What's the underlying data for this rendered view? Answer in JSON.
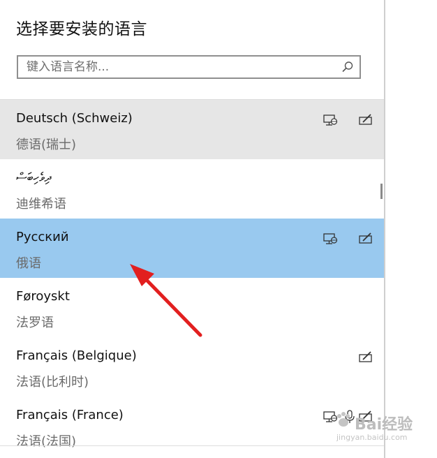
{
  "title": "选择要安装的语言",
  "search": {
    "placeholder": "键入语言名称..."
  },
  "languages": [
    {
      "name": "Deutsch (Schweiz)",
      "native": "德语(瑞士)",
      "state": "hover",
      "features": [
        "display",
        "handwriting"
      ]
    },
    {
      "name": "ދިވެހިބަސް",
      "native": "迪维希语",
      "state": "normal",
      "features": []
    },
    {
      "name": "Русский",
      "native": "俄语",
      "state": "selected",
      "features": [
        "display",
        "handwriting"
      ]
    },
    {
      "name": "Føroyskt",
      "native": "法罗语",
      "state": "normal",
      "features": []
    },
    {
      "name": "Français (Belgique)",
      "native": "法语(比利时)",
      "state": "normal",
      "features": [
        "handwriting"
      ]
    },
    {
      "name": "Français (France)",
      "native": "法语(法国)",
      "state": "normal",
      "features": [
        "display",
        "speech",
        "handwriting"
      ]
    }
  ],
  "colors": {
    "selected": "#99c9ef",
    "hover": "#e6e6e6",
    "arrow": "#e21f1f"
  },
  "watermark": {
    "text": "Bai经验",
    "sub": "jingyan.baidu.com"
  }
}
